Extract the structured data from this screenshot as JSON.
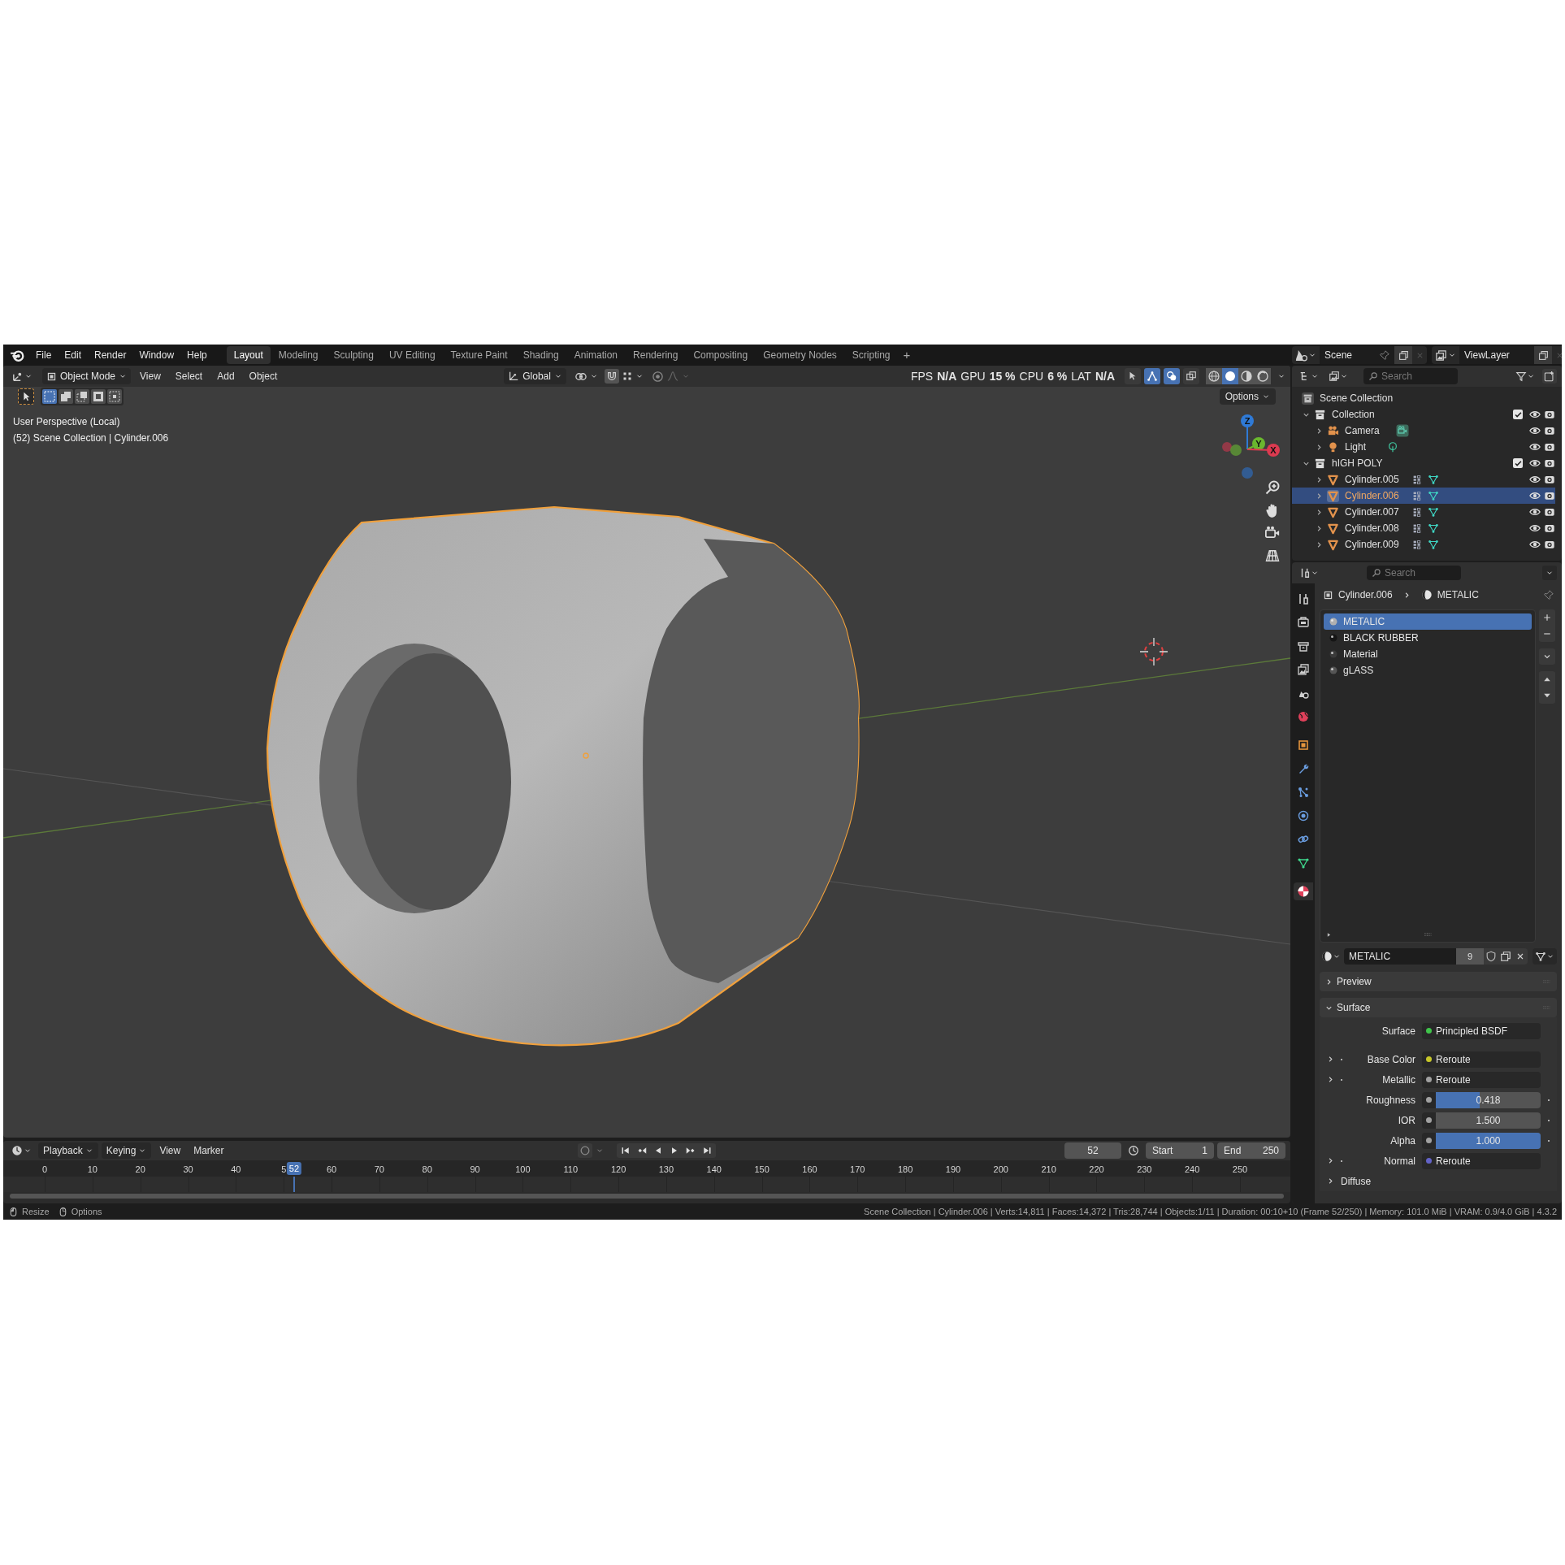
{
  "topbar": {
    "menus": [
      "File",
      "Edit",
      "Render",
      "Window",
      "Help"
    ],
    "workspaces": [
      {
        "label": "Layout",
        "selected": true
      },
      {
        "label": "Modeling",
        "selected": false
      },
      {
        "label": "Sculpting",
        "selected": false
      },
      {
        "label": "UV Editing",
        "selected": false
      },
      {
        "label": "Texture Paint",
        "selected": false
      },
      {
        "label": "Shading",
        "selected": false
      },
      {
        "label": "Animation",
        "selected": false
      },
      {
        "label": "Rendering",
        "selected": false
      },
      {
        "label": "Compositing",
        "selected": false
      },
      {
        "label": "Geometry Nodes",
        "selected": false
      },
      {
        "label": "Scripting",
        "selected": false
      }
    ],
    "add_workspace": "+",
    "scene": "Scene",
    "view_layer": "ViewLayer"
  },
  "viewport": {
    "mode": "Object Mode",
    "menus": [
      "View",
      "Select",
      "Add",
      "Object"
    ],
    "orientation": "Global",
    "stats": [
      {
        "label": "FPS",
        "value": "N/A"
      },
      {
        "label": "GPU",
        "value": "15 %"
      },
      {
        "label": "CPU",
        "value": "6 %"
      },
      {
        "label": "LAT",
        "value": "N/A"
      }
    ],
    "overlay_toggles": [
      {
        "kind": "selectability",
        "on": false
      },
      {
        "kind": "gizmo",
        "on": true
      },
      {
        "kind": "overlay",
        "on": true
      },
      {
        "kind": "xray",
        "on": false
      }
    ],
    "shading_modes": [
      {
        "kind": "wireframe",
        "selected": false
      },
      {
        "kind": "solid",
        "selected": true
      },
      {
        "kind": "material",
        "selected": false
      },
      {
        "kind": "rendered",
        "selected": false
      }
    ],
    "select_modes": [
      {
        "kind": "set",
        "selected": true
      },
      {
        "kind": "extend",
        "selected": false
      },
      {
        "kind": "subtract",
        "selected": false
      },
      {
        "kind": "invert",
        "selected": false
      },
      {
        "kind": "intersect",
        "selected": false
      }
    ],
    "options": "Options",
    "view_name": "User Perspective (Local)",
    "context": "(52) Scene Collection | Cylinder.006",
    "gizmo": [
      {
        "kind": "z",
        "label": "Z",
        "color": "#2f7ad6"
      },
      {
        "kind": "y",
        "label": "Y",
        "color": "#6ab72e"
      },
      {
        "kind": "x",
        "label": "X",
        "color": "#dc3a50"
      }
    ]
  },
  "timeline": {
    "menus": [
      "Playback",
      "Keying",
      "View",
      "Marker"
    ],
    "current_frame": "52",
    "start_label": "Start",
    "start": "1",
    "end_label": "End",
    "end": "250",
    "ticks": [
      "0",
      "10",
      "20",
      "30",
      "40",
      "5",
      "60",
      "70",
      "80",
      "90",
      "100",
      "110",
      "120",
      "130",
      "140",
      "150",
      "160",
      "170",
      "180",
      "190",
      "200",
      "210",
      "220",
      "230",
      "240",
      "250"
    ],
    "playhead": {
      "label": "52",
      "level": 0.208
    }
  },
  "outliner": {
    "search_placeholder": "Search",
    "tree": [
      {
        "label": "Scene Collection",
        "kind": "scene",
        "children": [
          {
            "label": "Collection",
            "kind": "collection",
            "expanded": true,
            "checked": true,
            "selected": false,
            "children": [
              {
                "label": "Camera",
                "kind": "camera",
                "expanded": false,
                "selected": false
              },
              {
                "label": "Light",
                "kind": "light",
                "expanded": false,
                "selected": false
              }
            ]
          },
          {
            "label": "hIGH POLY",
            "kind": "collection",
            "expanded": true,
            "checked": true,
            "selected": false,
            "children": [
              {
                "label": "Cylinder.005",
                "kind": "mesh",
                "expanded": false,
                "selected": false
              },
              {
                "label": "Cylinder.006",
                "kind": "mesh",
                "expanded": false,
                "selected": true
              },
              {
                "label": "Cylinder.007",
                "kind": "mesh",
                "expanded": false,
                "selected": false
              },
              {
                "label": "Cylinder.008",
                "kind": "mesh",
                "expanded": false,
                "selected": false
              },
              {
                "label": "Cylinder.009",
                "kind": "mesh",
                "expanded": false,
                "selected": false
              }
            ]
          }
        ]
      }
    ]
  },
  "properties": {
    "search_placeholder": "Search",
    "tabs": [
      {
        "kind": "tool",
        "selected": false
      },
      {
        "kind": "render",
        "selected": false
      },
      {
        "kind": "output",
        "selected": false
      },
      {
        "kind": "view_layer",
        "selected": false
      },
      {
        "kind": "scene",
        "selected": false
      },
      {
        "kind": "world",
        "selected": false
      },
      {
        "kind": "object",
        "selected": false
      },
      {
        "kind": "modifiers",
        "selected": false
      },
      {
        "kind": "particles",
        "selected": false
      },
      {
        "kind": "physics",
        "selected": false
      },
      {
        "kind": "constraints",
        "selected": false
      },
      {
        "kind": "data",
        "selected": false
      },
      {
        "kind": "material",
        "selected": true
      }
    ],
    "breadcrumb": {
      "object": "Cylinder.006",
      "material": "METALIC"
    },
    "slots": [
      {
        "label": "METALIC",
        "selected": true
      },
      {
        "label": "BLACK RUBBER",
        "selected": false
      },
      {
        "label": "Material",
        "selected": false
      },
      {
        "label": "gLASS",
        "selected": false
      }
    ],
    "material": {
      "name": "METALIC",
      "users": "9"
    },
    "panels": [
      {
        "title": "Preview",
        "expanded": false
      },
      {
        "title": "Surface",
        "expanded": true,
        "rows": [
          {
            "kind": "shader",
            "label": "Surface",
            "value": "Principled BSDF",
            "color": "#3fc44a"
          },
          {
            "kind": "link",
            "label": "Base Color",
            "value": "Reroute",
            "color": "#c7c729"
          },
          {
            "kind": "link",
            "label": "Metallic",
            "value": "Reroute",
            "color": "#a1a1a1"
          },
          {
            "kind": "slider",
            "label": "Roughness",
            "value": "0.418",
            "level": 0.418,
            "color": "#a1a1a1"
          },
          {
            "kind": "number",
            "label": "IOR",
            "value": "1.500",
            "color": "#a1a1a1"
          },
          {
            "kind": "slider",
            "label": "Alpha",
            "value": "1.000",
            "level": 1,
            "color": "#a1a1a1"
          },
          {
            "kind": "link",
            "label": "Normal",
            "value": "Reroute",
            "color": "#6363c7"
          },
          {
            "kind": "group",
            "label": "Diffuse"
          }
        ]
      }
    ]
  },
  "status_bar": {
    "hints": [
      {
        "kind": "mouse",
        "label": "Resize"
      },
      {
        "kind": "mouse-right",
        "label": "Options"
      }
    ],
    "stats": "Scene Collection | Cylinder.006 | Verts:14,811 | Faces:14,372 | Tris:28,744 | Objects:1/11 | Duration: 00:10+10 (Frame 52/250) | Memory: 101.0 MiB | VRAM: 0.9/4.0 GiB | 4.3.2"
  }
}
